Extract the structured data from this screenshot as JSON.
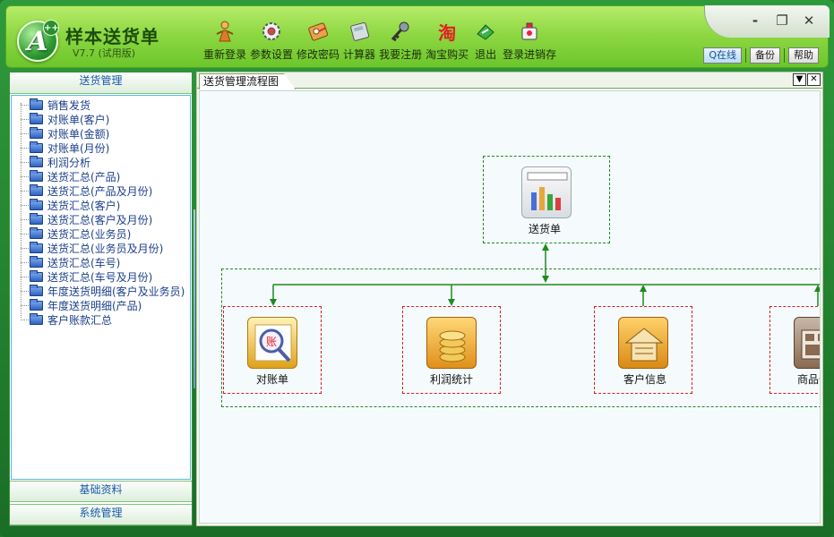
{
  "app": {
    "title": "样本送货单",
    "version": "V7.7 (试用版)",
    "logo_letter": "A",
    "logo_sup": "++"
  },
  "toolbar": [
    {
      "label": "重新登录",
      "icon": "relogin-icon"
    },
    {
      "label": "参数设置",
      "icon": "settings-gear-icon"
    },
    {
      "label": "修改密码",
      "icon": "password-key-icon"
    },
    {
      "label": "计算器",
      "icon": "calculator-icon"
    },
    {
      "label": "我要注册",
      "icon": "register-key-icon"
    },
    {
      "label": "淘宝购买",
      "icon": "taobao-icon",
      "glyph": "淘"
    },
    {
      "label": "退出",
      "icon": "exit-door-icon"
    },
    {
      "label": "登录进销存",
      "icon": "inventory-login-icon"
    }
  ],
  "window_controls": {
    "minimize": "-",
    "restore": "❐",
    "close": "✕"
  },
  "right_buttons": {
    "qq": "Q在线",
    "backup": "备份",
    "help": "帮助"
  },
  "sidebar": {
    "header": "送货管理",
    "items": [
      "销售发货",
      "对账单(客户)",
      "对账单(金额)",
      "对账单(月份)",
      "利润分析",
      "送货汇总(产品)",
      "送货汇总(产品及月份)",
      "送货汇总(客户)",
      "送货汇总(客户及月份)",
      "送货汇总(业务员)",
      "送货汇总(业务员及月份)",
      "送货汇总(车号)",
      "送货汇总(车号及月份)",
      "年度送货明细(客户及业务员)",
      "年度送货明细(产品)",
      "客户账款汇总"
    ],
    "footer_1": "基础资料",
    "footer_2": "系统管理"
  },
  "tab": {
    "label": "送货管理流程图",
    "menu": "▼",
    "close": "✕"
  },
  "flow": {
    "top": {
      "label": "送货单",
      "icon": "delivery-note-chart-icon"
    },
    "nodes": [
      {
        "label": "对账单",
        "icon": "statement-magnifier-icon"
      },
      {
        "label": "利润统计",
        "icon": "profit-coins-icon"
      },
      {
        "label": "客户信息",
        "icon": "customer-house-icon"
      },
      {
        "label": "商品信息",
        "icon": "product-info-icon"
      }
    ]
  },
  "colors": {
    "accent_green": "#1f8a1f",
    "dash_red": "#d61d1d",
    "header_green": "#8fd844",
    "link_blue": "#1b3f8a"
  }
}
